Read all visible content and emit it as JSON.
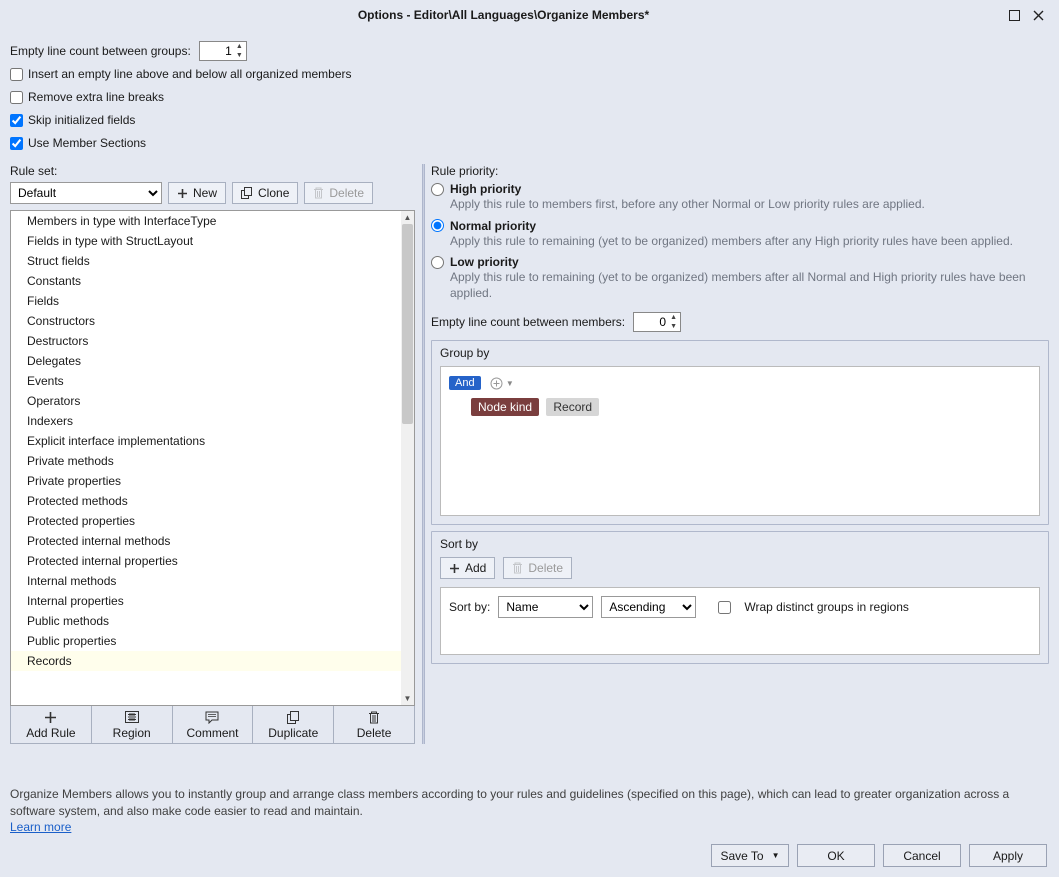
{
  "title": "Options - Editor\\All Languages\\Organize Members*",
  "top": {
    "empty_line_label": "Empty line count between groups:",
    "empty_line_value": "1",
    "insert_empty_label": "Insert an empty line above and below all organized members",
    "remove_extra_label": "Remove extra line breaks",
    "skip_init_label": "Skip initialized fields",
    "use_member_sections_label": "Use Member Sections"
  },
  "ruleset": {
    "label": "Rule set:",
    "selected": "Default",
    "new_btn": "New",
    "clone_btn": "Clone",
    "delete_btn": "Delete"
  },
  "rules": [
    "Members in type with InterfaceType",
    "Fields in type with StructLayout",
    "Struct fields",
    "Constants",
    "Fields",
    "Constructors",
    "Destructors",
    "Delegates",
    "Events",
    "Operators",
    "Indexers",
    "Explicit interface implementations",
    "Private methods",
    "Private properties",
    "Protected methods",
    "Protected properties",
    "Protected internal methods",
    "Protected internal properties",
    "Internal methods",
    "Internal properties",
    "Public methods",
    "Public properties",
    "Records"
  ],
  "selected_rule_index": 22,
  "toolbar": {
    "add_rule": "Add Rule",
    "region": "Region",
    "comment": "Comment",
    "duplicate": "Duplicate",
    "delete": "Delete"
  },
  "priority": {
    "label": "Rule priority:",
    "high": {
      "label": "High priority",
      "desc": "Apply this rule to members first, before any other Normal or Low priority rules are applied."
    },
    "normal": {
      "label": "Normal priority",
      "desc": "Apply this rule to remaining (yet to be organized) members after any High priority rules have been applied."
    },
    "low": {
      "label": "Low priority",
      "desc": "Apply this rule to remaining (yet to be organized) members after all Normal and High priority rules have been applied."
    },
    "selected": "normal"
  },
  "empty_between_members": {
    "label": "Empty line count between members:",
    "value": "0"
  },
  "groupby": {
    "title": "Group by",
    "and": "And",
    "nodekind": "Node kind",
    "record": "Record"
  },
  "sortby": {
    "title": "Sort by",
    "add_btn": "Add",
    "delete_btn": "Delete",
    "sortby_label": "Sort by:",
    "field": "Name",
    "direction": "Ascending",
    "wrap_label": "Wrap distinct groups in regions"
  },
  "footer": {
    "text": "Organize Members allows you to instantly group and arrange class members according to your rules and guidelines (specified on this page), which can lead to greater organization across a software system, and also make code easier to read and maintain.",
    "learn_more": "Learn more"
  },
  "buttons": {
    "save_to": "Save To",
    "ok": "OK",
    "cancel": "Cancel",
    "apply": "Apply"
  }
}
